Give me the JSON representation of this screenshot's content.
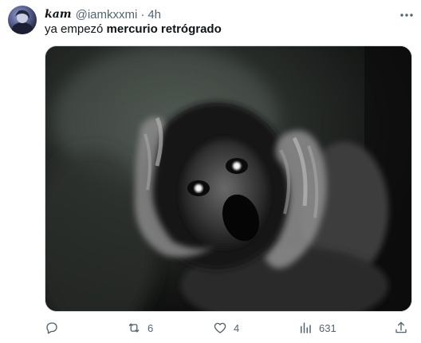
{
  "tweet": {
    "author": {
      "display_name": "kam",
      "handle": "@iamkxxmi",
      "separator": "·",
      "time": "4h"
    },
    "text_plain": "ya empezó ",
    "text_bold": "mercurio retrógrado",
    "actions": {
      "reply_count": "",
      "retweet_count": "6",
      "like_count": "4",
      "views_count": "631"
    },
    "icons": {
      "more": "more-horizontal-icon",
      "reply": "reply-icon",
      "retweet": "retweet-icon",
      "like": "heart-icon",
      "views": "views-chart-icon",
      "share": "share-upload-icon"
    },
    "colors": {
      "text": "#0f1419",
      "secondary": "#536471",
      "border": "#cfd9de"
    }
  }
}
